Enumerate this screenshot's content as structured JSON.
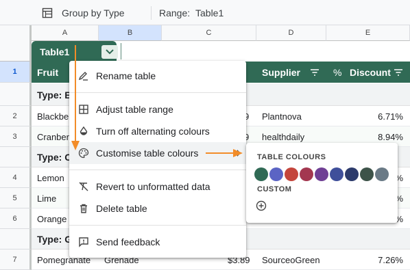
{
  "toolbar": {
    "group_label": "Group by Type",
    "range_label": "Range:",
    "range_value": "Table1"
  },
  "columns": [
    "A",
    "B",
    "C",
    "D",
    "E"
  ],
  "rows": [
    "1",
    "2",
    "3",
    "4",
    "5",
    "6",
    "7"
  ],
  "table": {
    "name": "Table1",
    "headers": {
      "fruit": "Fruit",
      "supplier": "Supplier",
      "discount": "Discount",
      "percent_symbol": "%"
    },
    "groups": [
      "Type: B",
      "Type: C",
      "Type: G"
    ],
    "data_rows": [
      {
        "fruit": "Blackbe",
        "price": "9",
        "supplier": "Plantnova",
        "discount": "6.71%"
      },
      {
        "fruit": "Cranber",
        "price": "9",
        "supplier": "healthdaily",
        "discount": "8.94%"
      },
      {
        "fruit": "Lemon",
        "discount": "%"
      },
      {
        "fruit": "Lime",
        "discount": "%"
      },
      {
        "fruit": "Orange",
        "discount": "%"
      },
      {
        "fruit": "Pomegranate",
        "variety": "Grenade",
        "price": "$3.89",
        "supplier": "SourceoGreen",
        "discount": "7.26%"
      }
    ]
  },
  "menu": {
    "items": [
      {
        "label": "Rename table",
        "icon": "rename-icon"
      },
      {
        "label": "Adjust table range",
        "icon": "grid-icon"
      },
      {
        "label": "Turn off alternating colours",
        "icon": "drop-icon"
      },
      {
        "label": "Customise table colours",
        "icon": "palette-icon"
      },
      {
        "label": "Revert to unformatted data",
        "icon": "clear-format-icon"
      },
      {
        "label": "Delete table",
        "icon": "trash-icon"
      },
      {
        "label": "Send feedback",
        "icon": "feedback-icon"
      }
    ]
  },
  "table_colours": {
    "title": "TABLE COLOURS",
    "custom_title": "CUSTOM",
    "swatches": [
      "#306a55",
      "#5b64c4",
      "#c4453c",
      "#a33750",
      "#6f3f94",
      "#3f4f9a",
      "#2c3a6b",
      "#3d5349",
      "#6a7a86"
    ]
  },
  "colors": {
    "table_green": "#306a55",
    "arrow_orange": "#f28c28"
  }
}
